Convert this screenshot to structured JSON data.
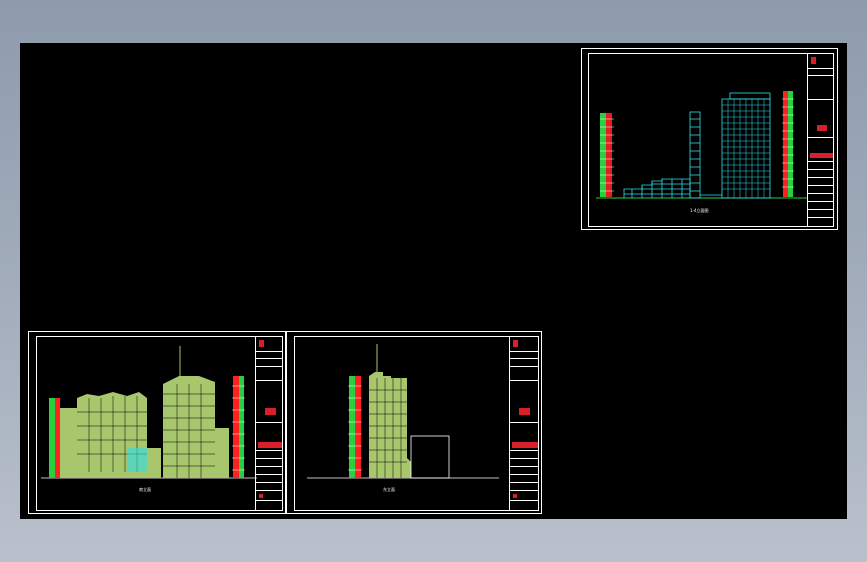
{
  "window": {
    "title": ""
  },
  "colors": {
    "background_top": "#8e9bac",
    "background_bottom": "#b9c1cc",
    "canvas": "#000000",
    "sheet_border": "#ffffff",
    "building_fill": "#a8c66c",
    "building_cyan": "#2de0ea",
    "facade_red": "#ff2020",
    "facade_green": "#28d040",
    "titleblock_red": "#d8202a"
  },
  "sheets": [
    {
      "id": "sheet-top-right",
      "caption": "1-4立面图",
      "kind": "cyan-section"
    },
    {
      "id": "sheet-bottom-left",
      "caption": "南立面",
      "kind": "green-elevation-wide"
    },
    {
      "id": "sheet-bottom-middle",
      "caption": "东立面",
      "kind": "green-elevation-narrow"
    }
  ]
}
